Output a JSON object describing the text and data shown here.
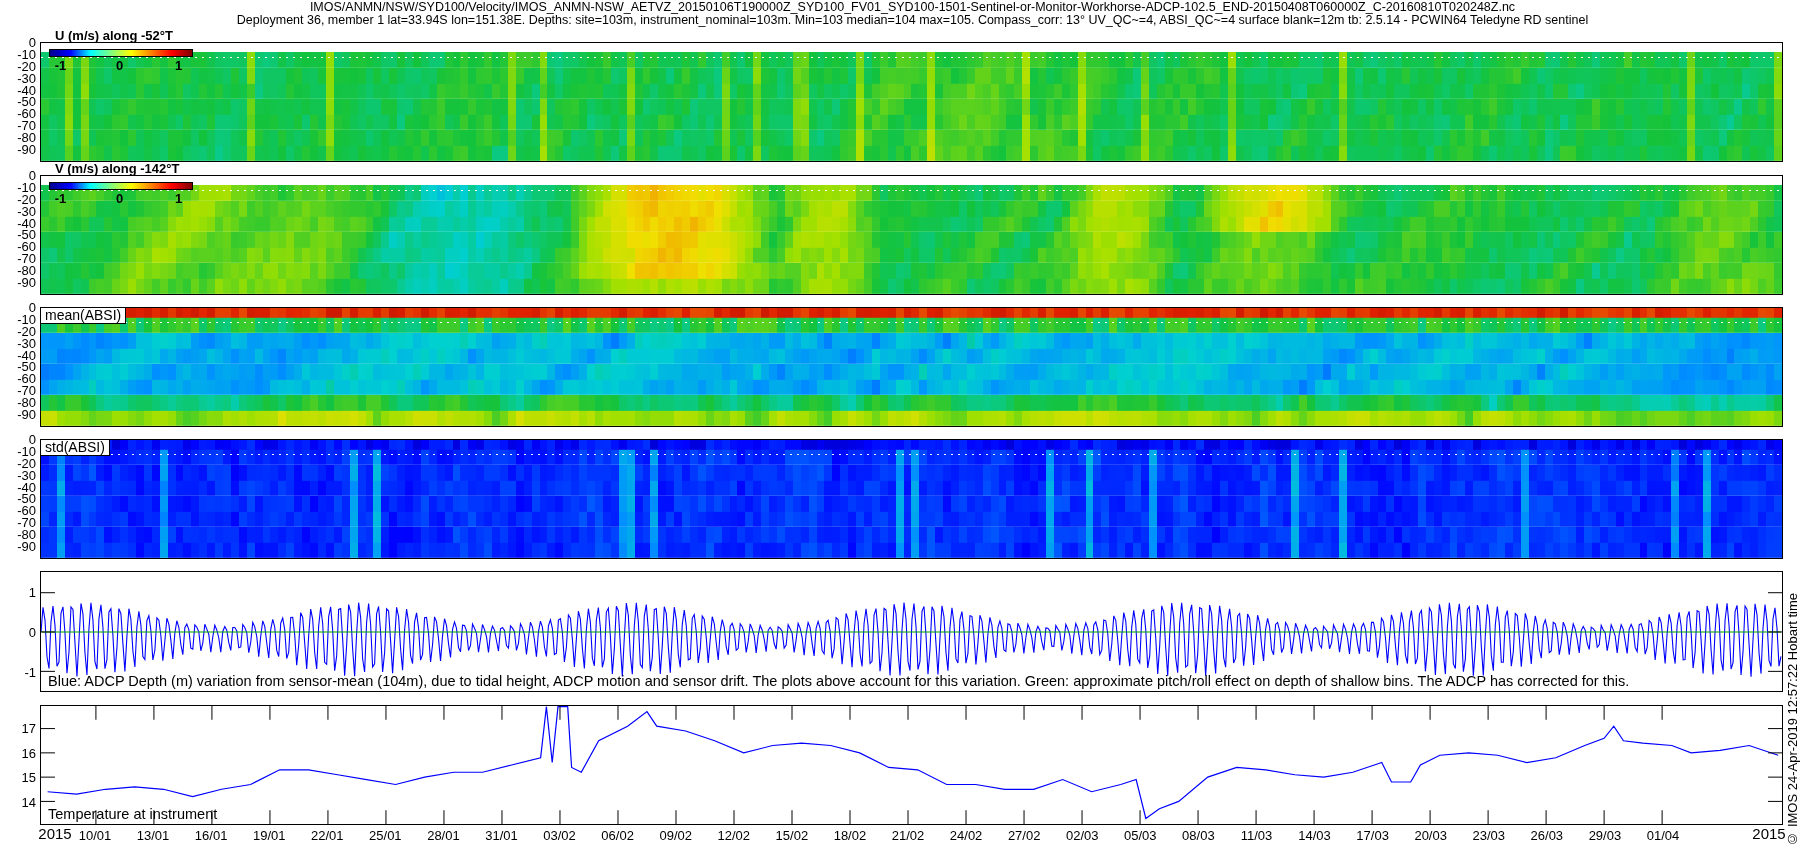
{
  "header": {
    "lines": [
      "IMOS/ANMN/NSW/SYD100/Velocity/IMOS_ANMN-NSW_AETVZ_20150106T190000Z_SYD100_FV01_SYD100-1501-Sentinel-or-Monitor-Workhorse-ADCP-102.5_END-20150408T060000Z_C-20160810T020248Z.nc",
      "Deployment 36, member 1 lat=33.94S lon=151.38E. Depths: site=103m, instrument_nominal=103m. Min=103 median=104 max=105. Compass_corr: 13° UV_QC~=4, ABSI_QC~=4 surface blank=12m tb: 2.5.14 - PCWIN64 Teledyne RD sentinel"
    ]
  },
  "heatmap_panels": [
    {
      "kind": "u",
      "title": "U (m/s) along -52°T",
      "yticks": [
        "0",
        "-10",
        "-20",
        "-30",
        "-40",
        "-50",
        "-60",
        "-70",
        "-80",
        "-90"
      ],
      "colorbar_ticks": [
        "-1",
        "0",
        "1"
      ]
    },
    {
      "kind": "v",
      "title": "V (m/s) along -142°T",
      "yticks": [
        "0",
        "-10",
        "-20",
        "-30",
        "-40",
        "-50",
        "-60",
        "-70",
        "-80",
        "-90"
      ],
      "colorbar_ticks": [
        "-1",
        "0",
        "1"
      ]
    },
    {
      "kind": "mean",
      "label": "mean(ABSI)",
      "yticks": [
        "0",
        "-10",
        "-20",
        "-30",
        "-40",
        "-50",
        "-60",
        "-70",
        "-80",
        "-90"
      ]
    },
    {
      "kind": "std",
      "label": "std(ABSI)",
      "yticks": [
        "0",
        "-10",
        "-20",
        "-30",
        "-40",
        "-50",
        "-60",
        "-70",
        "-80",
        "-90"
      ]
    }
  ],
  "depth_panel": {
    "yticks": [
      "1",
      "0",
      "-1"
    ],
    "caption": "Blue: ADCP Depth (m) variation from sensor-mean (104m), due to tidal height, ADCP motion and sensor drift. The plots above account for this variation. Green: approximate pitch/roll effect on depth of shallow bins. The ADCP has corrected for this."
  },
  "temperature_panel": {
    "chart_data": {
      "type": "line",
      "x": [
        "2015-01-07T12:00",
        "2015-01-09",
        "2015-01-10T12:00",
        "2015-01-12",
        "2015-01-13T12:00",
        "2015-01-15",
        "2015-01-16T12:00",
        "2015-01-18",
        "2015-01-19T12:00",
        "2015-01-21",
        "2015-01-22T12:00",
        "2015-01-24",
        "2015-01-25T12:00",
        "2015-01-27",
        "2015-01-28T12:00",
        "2015-01-30",
        "2015-01-31T12:00",
        "2015-02-02",
        "2015-02-02T07:12",
        "2015-02-02T14:24",
        "2015-02-02T21:36",
        "2015-02-03T09:36",
        "2015-02-03T14:24",
        "2015-02-04T02:24",
        "2015-02-05",
        "2015-02-06T12:00",
        "2015-02-07T12:00",
        "2015-02-08",
        "2015-02-09T12:00",
        "2015-02-11",
        "2015-02-12T12:00",
        "2015-02-14",
        "2015-02-15T12:00",
        "2015-02-17",
        "2015-02-18T12:00",
        "2015-02-20",
        "2015-02-21T12:00",
        "2015-02-23",
        "2015-02-24T12:00",
        "2015-02-26",
        "2015-02-27T12:00",
        "2015-03-01",
        "2015-03-02T12:00",
        "2015-03-04",
        "2015-03-04T19:12",
        "2015-03-05T07:12",
        "2015-03-06",
        "2015-03-07",
        "2015-03-08T12:00",
        "2015-03-10",
        "2015-03-11T12:00",
        "2015-03-13",
        "2015-03-14T12:00",
        "2015-03-16",
        "2015-03-17T12:00",
        "2015-03-18",
        "2015-03-19",
        "2015-03-19T12:00",
        "2015-03-20T12:00",
        "2015-03-22",
        "2015-03-23T12:00",
        "2015-03-25",
        "2015-03-26T12:00",
        "2015-03-28",
        "2015-03-29",
        "2015-03-29T12:00",
        "2015-03-30",
        "2015-03-31",
        "2015-04-01T12:00",
        "2015-04-02T12:00",
        "2015-04-04",
        "2015-04-05T12:00",
        "2015-04-07"
      ],
      "series": [
        {
          "name": "Temperature at instrument",
          "color": "#0000ff",
          "values": [
            14.4,
            14.3,
            14.5,
            14.6,
            14.5,
            14.2,
            14.5,
            14.7,
            15.3,
            15.3,
            15.1,
            14.9,
            14.7,
            15.0,
            15.2,
            15.2,
            15.5,
            15.8,
            17.9,
            15.6,
            17.9,
            17.9,
            15.4,
            15.2,
            16.5,
            17.1,
            17.7,
            17.1,
            16.9,
            16.5,
            16.0,
            16.3,
            16.4,
            16.3,
            16.0,
            15.4,
            15.3,
            14.7,
            14.7,
            14.5,
            14.5,
            14.9,
            14.4,
            14.7,
            14.9,
            13.3,
            13.7,
            14.0,
            15.0,
            15.4,
            15.3,
            15.1,
            15.0,
            15.2,
            15.6,
            14.8,
            14.8,
            15.5,
            15.9,
            16.0,
            15.9,
            15.6,
            15.8,
            16.3,
            16.6,
            17.1,
            16.5,
            16.4,
            16.3,
            16.0,
            16.1,
            16.3,
            15.9
          ]
        }
      ],
      "xlim": [
        "2015-01-07T03:50",
        "2015-04-07T04:48"
      ],
      "ylim": [
        13.07,
        17.93
      ],
      "xticks": [
        {
          "value": "2015-01-10",
          "label": "10/01"
        },
        {
          "value": "2015-01-13",
          "label": "13/01"
        },
        {
          "value": "2015-01-16",
          "label": "16/01"
        },
        {
          "value": "2015-01-19",
          "label": "19/01"
        },
        {
          "value": "2015-01-22",
          "label": "22/01"
        },
        {
          "value": "2015-01-25",
          "label": "25/01"
        },
        {
          "value": "2015-01-28",
          "label": "28/01"
        },
        {
          "value": "2015-01-31",
          "label": "31/01"
        },
        {
          "value": "2015-02-03",
          "label": "03/02"
        },
        {
          "value": "2015-02-06",
          "label": "06/02"
        },
        {
          "value": "2015-02-09",
          "label": "09/02"
        },
        {
          "value": "2015-02-12",
          "label": "12/02"
        },
        {
          "value": "2015-02-15",
          "label": "15/02"
        },
        {
          "value": "2015-02-18",
          "label": "18/02"
        },
        {
          "value": "2015-02-21",
          "label": "21/02"
        },
        {
          "value": "2015-02-24",
          "label": "24/02"
        },
        {
          "value": "2015-02-27",
          "label": "27/02"
        },
        {
          "value": "2015-03-02",
          "label": "02/03"
        },
        {
          "value": "2015-03-05",
          "label": "05/03"
        },
        {
          "value": "2015-03-08",
          "label": "08/03"
        },
        {
          "value": "2015-03-11",
          "label": "11/03"
        },
        {
          "value": "2015-03-14",
          "label": "14/03"
        },
        {
          "value": "2015-03-17",
          "label": "17/03"
        },
        {
          "value": "2015-03-20",
          "label": "20/03"
        },
        {
          "value": "2015-03-23",
          "label": "23/03"
        },
        {
          "value": "2015-03-26",
          "label": "26/03"
        },
        {
          "value": "2015-03-29",
          "label": "29/03"
        },
        {
          "value": "2015-04-01",
          "label": "01/04"
        }
      ],
      "yticks": [
        17,
        16,
        15,
        14
      ]
    }
  },
  "x_axis": {
    "start_label": "2015",
    "end_label": "2015"
  },
  "side_note": "© IMOS 24-Apr-2019 12:57:22 Hobart time"
}
